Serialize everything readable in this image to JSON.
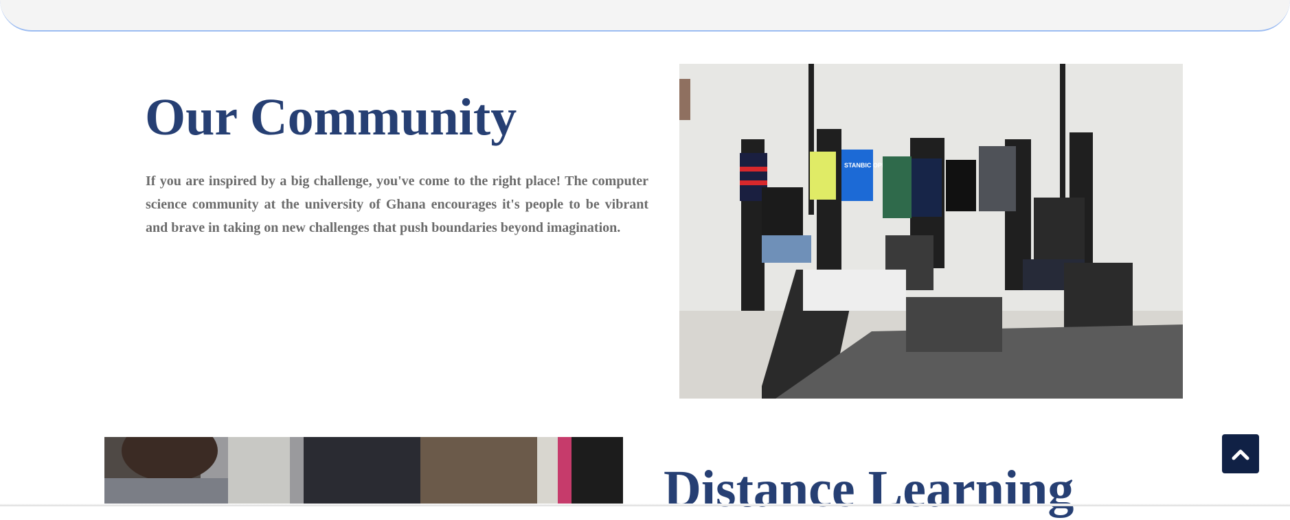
{
  "community": {
    "title": "Our Community",
    "body": "If you are inspired by a big challenge, you've come to the right place! The computer science community at the university of Ghana encourages it's people to be vibrant and brave in taking on new challenges that push boundaries beyond imagination.",
    "photo_shirt_text": "STANBIC OPEN BANKING"
  },
  "distance_learning": {
    "title": "Distance Learning"
  },
  "scroll_top": {
    "icon": "chevron-up-icon"
  },
  "colors": {
    "heading": "#263f73",
    "body_text": "#6b6b6b",
    "scroll_button": "#102145",
    "topbar_border": "#9bbcf2"
  }
}
